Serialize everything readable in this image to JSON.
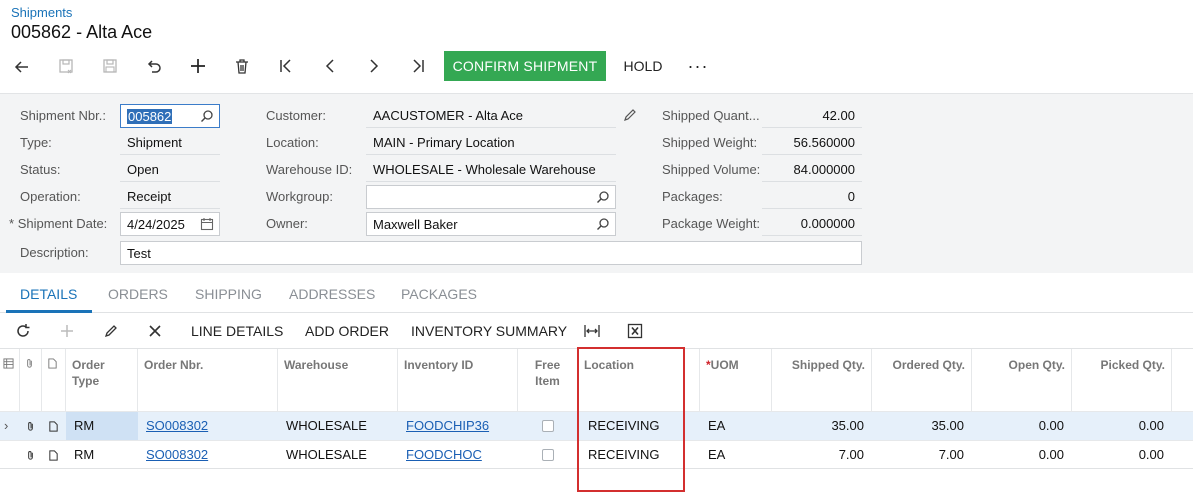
{
  "header": {
    "breadcrumb": "Shipments",
    "title": "005862 - Alta Ace"
  },
  "toolbar": {
    "icons": [
      "back-icon",
      "save-close-icon",
      "save-icon",
      "undo-icon",
      "add-icon",
      "delete-icon",
      "first-icon",
      "prev-icon",
      "next-icon",
      "last-icon"
    ],
    "confirm_label": "CONFIRM SHIPMENT",
    "hold_label": "HOLD",
    "more_label": "···",
    "confirm_color": "#34a853"
  },
  "form": {
    "shipment_nbr": {
      "label": "Shipment Nbr.:",
      "value": "005862"
    },
    "type": {
      "label": "Type:",
      "value": "Shipment"
    },
    "status": {
      "label": "Status:",
      "value": "Open"
    },
    "operation": {
      "label": "Operation:",
      "value": "Receipt"
    },
    "shipment_date": {
      "label": "Shipment Date:",
      "value": "4/24/2025",
      "required_mark": "*"
    },
    "description": {
      "label": "Description:",
      "value": "Test"
    },
    "customer": {
      "label": "Customer:",
      "value": "AACUSTOMER - Alta Ace"
    },
    "location": {
      "label": "Location:",
      "value": "MAIN - Primary Location"
    },
    "warehouse": {
      "label": "Warehouse ID:",
      "value": "WHOLESALE - Wholesale Warehouse"
    },
    "workgroup": {
      "label": "Workgroup:",
      "value": ""
    },
    "owner": {
      "label": "Owner:",
      "value": "Maxwell Baker"
    },
    "shipped_quantity": {
      "label": "Shipped Quant...",
      "value": "42.00"
    },
    "shipped_weight": {
      "label": "Shipped Weight:",
      "value": "56.560000"
    },
    "shipped_volume": {
      "label": "Shipped Volume:",
      "value": "84.000000"
    },
    "packages": {
      "label": "Packages:",
      "value": "0"
    },
    "package_weight": {
      "label": "Package Weight:",
      "value": "0.000000"
    }
  },
  "tabs": [
    "DETAILS",
    "ORDERS",
    "SHIPPING",
    "ADDRESSES",
    "PACKAGES"
  ],
  "active_tab": "DETAILS",
  "grid_toolbar": {
    "line_details": "LINE DETAILS",
    "add_order": "ADD ORDER",
    "inventory_summary": "INVENTORY SUMMARY"
  },
  "grid": {
    "columns": {
      "order_type": "Order Type",
      "order_nbr": "Order Nbr.",
      "warehouse": "Warehouse",
      "inventory_id": "Inventory ID",
      "free_item": "Free Item",
      "location": "Location",
      "uom_required": "*",
      "uom": "UOM",
      "shipped_qty": "Shipped Qty.",
      "ordered_qty": "Ordered Qty.",
      "open_qty": "Open Qty.",
      "picked_qty": "Picked Qty."
    },
    "rows": [
      {
        "order_type": "RM",
        "order_nbr": "SO008302",
        "warehouse": "WHOLESALE",
        "inventory_id": "FOODCHIP36",
        "free_item": false,
        "location": "RECEIVING",
        "uom": "EA",
        "shipped_qty": "35.00",
        "ordered_qty": "35.00",
        "open_qty": "0.00",
        "picked_qty": "0.00"
      },
      {
        "order_type": "RM",
        "order_nbr": "SO008302",
        "warehouse": "WHOLESALE",
        "inventory_id": "FOODCHOC",
        "free_item": false,
        "location": "RECEIVING",
        "uom": "EA",
        "shipped_qty": "7.00",
        "ordered_qty": "7.00",
        "open_qty": "0.00",
        "picked_qty": "0.00"
      }
    ]
  },
  "colors": {
    "accent": "#1a73b8",
    "highlight_box": "#d32f2f"
  }
}
